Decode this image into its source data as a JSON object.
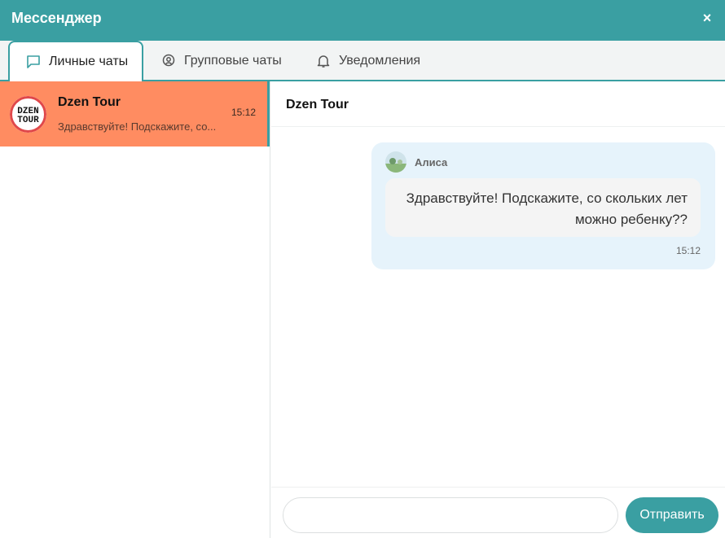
{
  "window": {
    "title": "Мессенджер",
    "close_label": "×"
  },
  "tabs": [
    {
      "label": "Личные чаты",
      "icon": "chat-bubble-icon",
      "active": true
    },
    {
      "label": "Групповые чаты",
      "icon": "location-pin-icon",
      "active": false
    },
    {
      "label": "Уведомления",
      "icon": "bell-icon",
      "active": false
    }
  ],
  "chat_list": [
    {
      "name": "Dzen Tour",
      "preview": "Здравствуйте! Подскажите, со...",
      "time": "15:12",
      "avatar_text": "DZEN TOUR",
      "selected": true
    }
  ],
  "conversation": {
    "title": "Dzen Tour",
    "messages": [
      {
        "author": "Алиса",
        "text": "Здравствуйте! Подскажите, со скольких лет можно ребенку??",
        "time": "15:12"
      }
    ]
  },
  "composer": {
    "placeholder": "",
    "value": "",
    "send_label": "Отправить"
  },
  "colors": {
    "accent": "#3a9fa2",
    "selected_chat": "#ff8c61",
    "message_bg": "#e6f3fb",
    "bubble_bg": "#f4f4f4"
  }
}
